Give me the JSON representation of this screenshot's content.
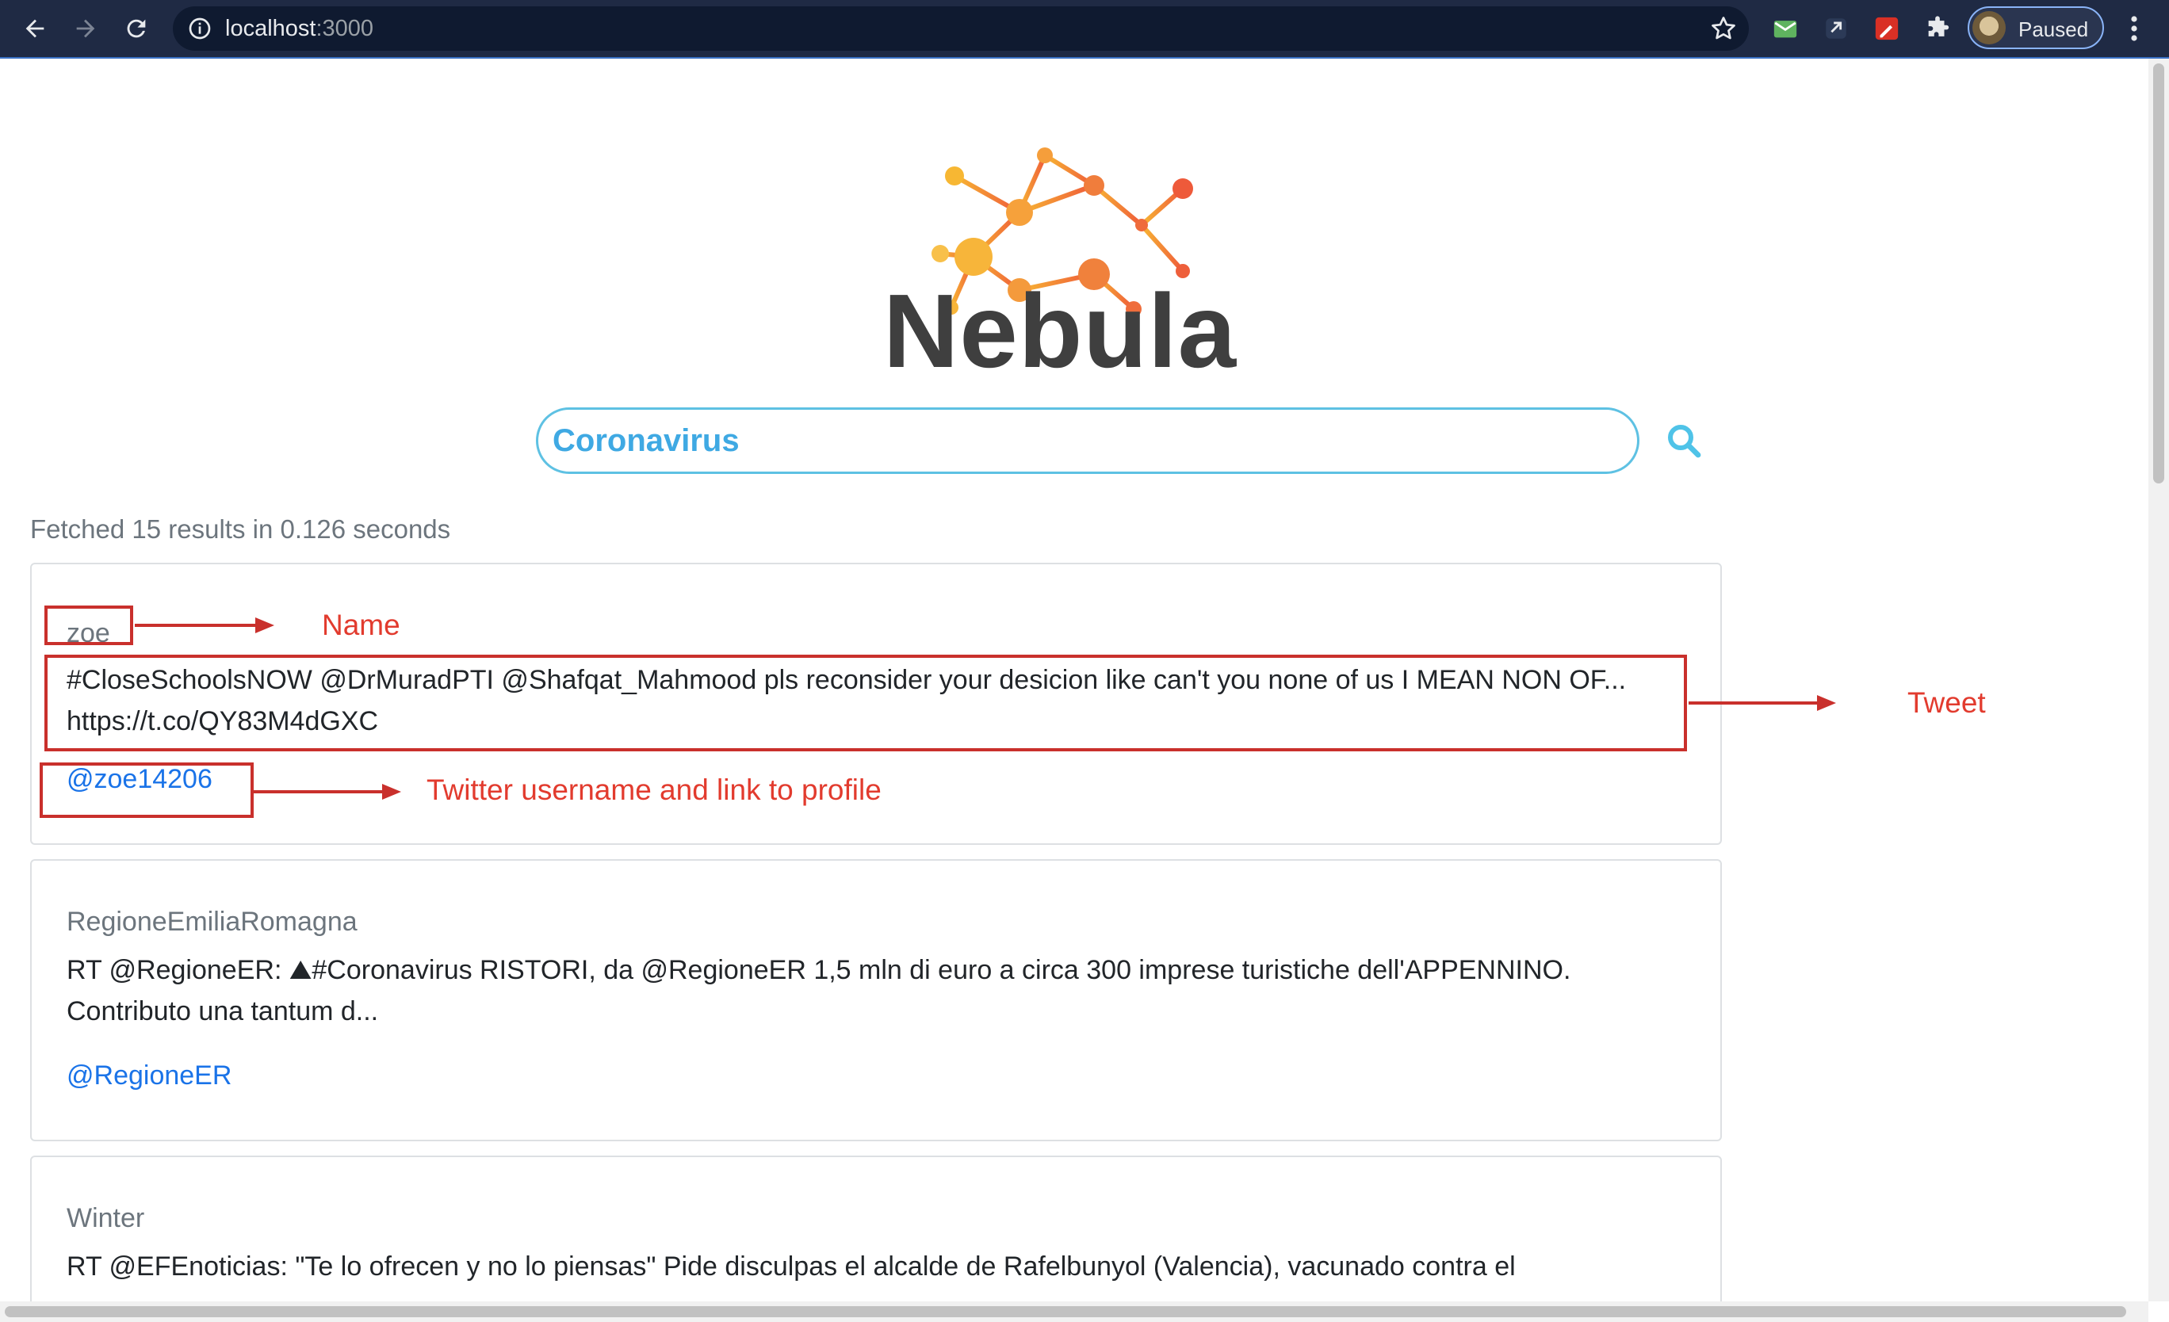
{
  "browser": {
    "url_host": "localhost",
    "url_port": ":3000",
    "profile_label": "Paused"
  },
  "app": {
    "logo_text": "Nebula"
  },
  "search": {
    "value": "Coronavirus"
  },
  "results_meta": "Fetched 15 results in 0.126 seconds",
  "results": [
    {
      "name": "zoe",
      "tweet_line1": "#CloseSchoolsNOW @DrMuradPTI @Shafqat_Mahmood pls reconsider your desicion like can't you none of us I MEAN NON OF...",
      "tweet_line2": "https://t.co/QY83M4dGXC",
      "handle": "@zoe14206"
    },
    {
      "name": "RegioneEmiliaRomagna",
      "tweet_line1": "RT @RegioneER: ⛰#Coronavirus RISTORI, da @RegioneER 1,5 mln di euro a circa 300 imprese turistiche dell'APPENNINO.",
      "tweet_line2": "Contributo una tantum d...",
      "handle": "@RegioneER"
    },
    {
      "name": "Winter",
      "tweet_line1": "RT @EFEnoticias: \"Te lo ofrecen y no lo piensas\" Pide disculpas el alcalde de Rafelbunyol (Valencia), vacunado contra el"
    }
  ],
  "annotations": {
    "name": "Name",
    "tweet": "Tweet",
    "username": "Twitter username and link to profile"
  },
  "colors": {
    "annotation": "#c9302c",
    "search_border": "#5ec1e3",
    "link": "#1a73e8"
  }
}
